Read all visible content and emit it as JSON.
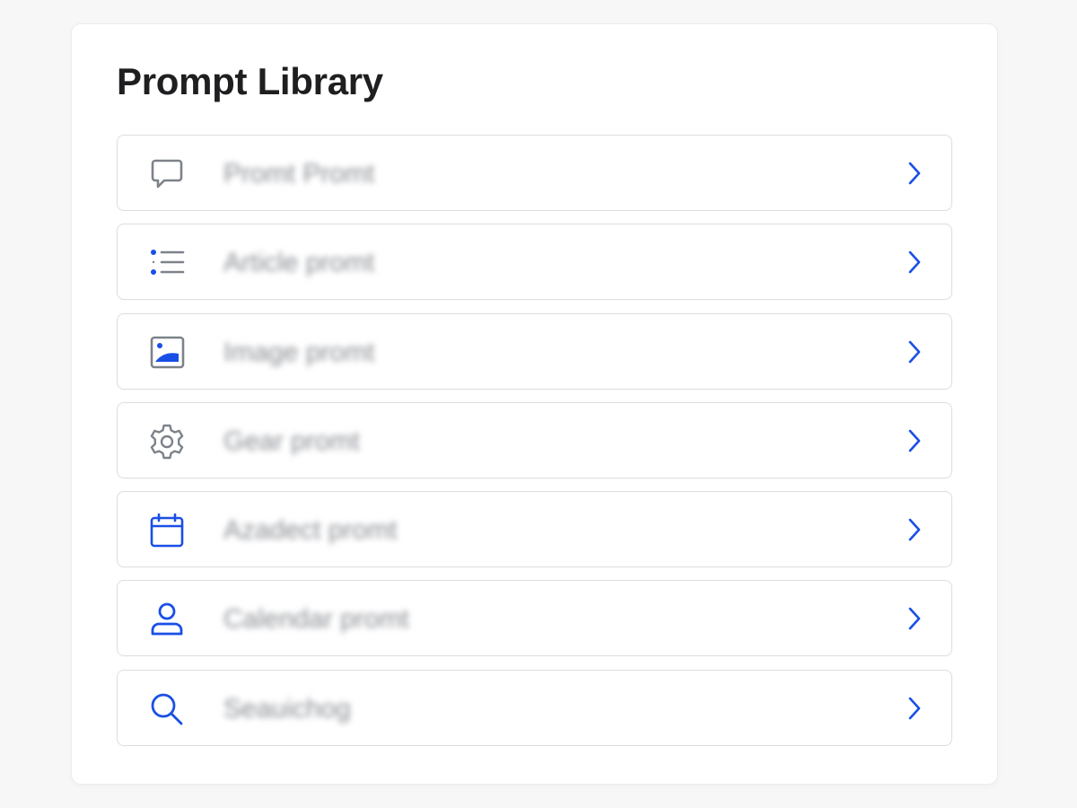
{
  "page": {
    "title": "Prompt Library"
  },
  "colors": {
    "accent": "#1a4fe6",
    "icon_gray": "#7d828a",
    "label_gray": "#8a8d93"
  },
  "items": [
    {
      "label": "Promt Promt",
      "icon": "speech-bubble-icon"
    },
    {
      "label": "Article promt",
      "icon": "bullet-list-icon"
    },
    {
      "label": "Image promt",
      "icon": "image-icon"
    },
    {
      "label": "Gear promt",
      "icon": "gear-icon"
    },
    {
      "label": "Azadect promt",
      "icon": "calendar-icon"
    },
    {
      "label": "Calendar promt",
      "icon": "user-icon"
    },
    {
      "label": "Seauichog",
      "icon": "search-icon"
    }
  ]
}
